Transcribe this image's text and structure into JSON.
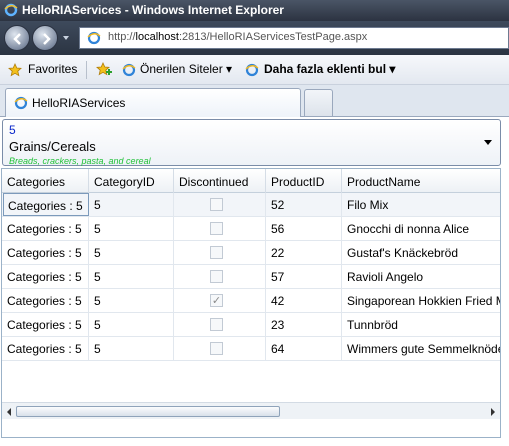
{
  "window": {
    "title": "HelloRIAServices - Windows Internet Explorer"
  },
  "address": {
    "prefix": "http://",
    "host": "localhost",
    "rest": ":2813/HelloRIAServicesTestPage.aspx"
  },
  "favorites_bar": {
    "favorites_label": "Favorites",
    "suggested_label": "Önerilen Siteler ▾",
    "addons_label": "Daha fazla eklenti bul ▾"
  },
  "tab": {
    "label": "HelloRIAServices"
  },
  "combo": {
    "id": "5",
    "name": "Grains/Cereals",
    "description": "Breads, crackers, pasta, and cereal"
  },
  "grid": {
    "columns": [
      "Categories",
      "CategoryID",
      "Discontinued",
      "ProductID",
      "ProductName"
    ],
    "rows": [
      {
        "categories": "Categories : 5",
        "category_id": "5",
        "discontinued": false,
        "product_id": "52",
        "product_name": "Filo Mix"
      },
      {
        "categories": "Categories : 5",
        "category_id": "5",
        "discontinued": false,
        "product_id": "56",
        "product_name": "Gnocchi di nonna Alice"
      },
      {
        "categories": "Categories : 5",
        "category_id": "5",
        "discontinued": false,
        "product_id": "22",
        "product_name": "Gustaf's Knäckebröd"
      },
      {
        "categories": "Categories : 5",
        "category_id": "5",
        "discontinued": false,
        "product_id": "57",
        "product_name": "Ravioli Angelo"
      },
      {
        "categories": "Categories : 5",
        "category_id": "5",
        "discontinued": true,
        "product_id": "42",
        "product_name": "Singaporean Hokkien Fried Mee"
      },
      {
        "categories": "Categories : 5",
        "category_id": "5",
        "discontinued": false,
        "product_id": "23",
        "product_name": "Tunnbröd"
      },
      {
        "categories": "Categories : 5",
        "category_id": "5",
        "discontinued": false,
        "product_id": "64",
        "product_name": "Wimmers gute Semmelknödel"
      }
    ]
  },
  "colors": {
    "accent": "#0a27c9",
    "description_green": "#23c23a"
  }
}
